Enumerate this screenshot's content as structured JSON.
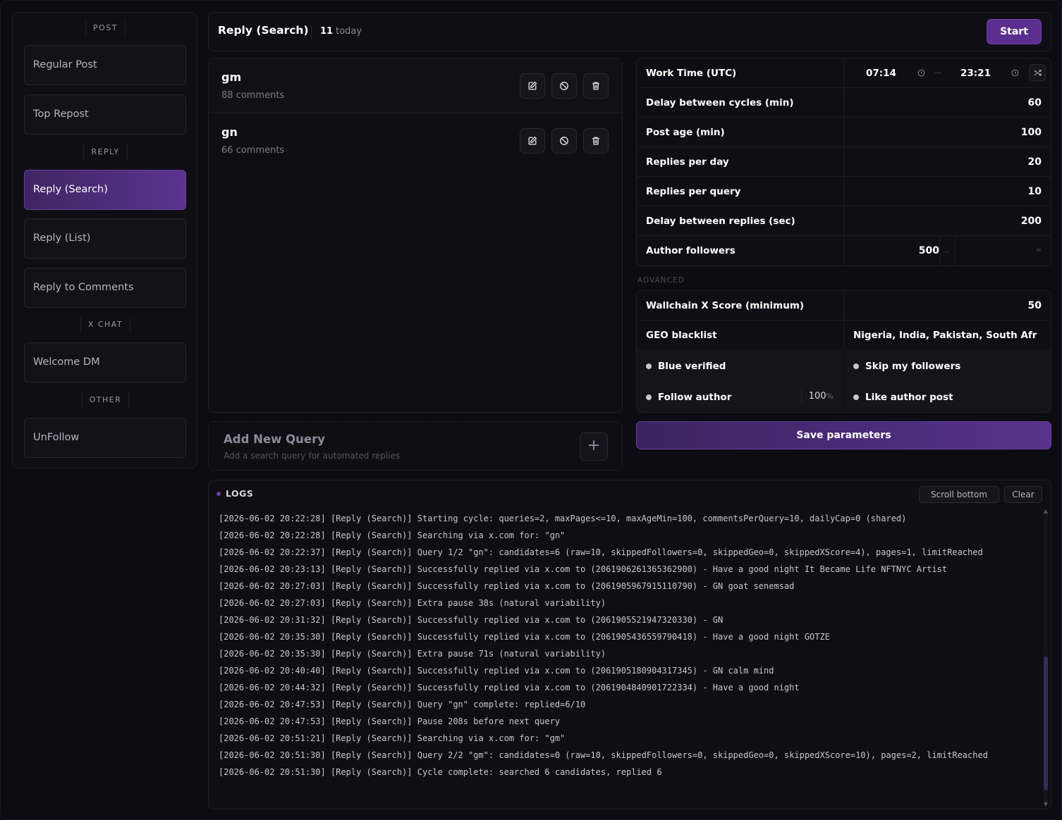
{
  "sidebar": {
    "sections": [
      {
        "label": "POST",
        "items": [
          "Regular Post",
          "Top Repost"
        ]
      },
      {
        "label": "REPLY",
        "items": [
          "Reply (Search)",
          "Reply (List)",
          "Reply to Comments"
        ]
      },
      {
        "label": "X CHAT",
        "items": [
          "Welcome DM"
        ]
      },
      {
        "label": "OTHER",
        "items": [
          "UnFollow"
        ]
      }
    ],
    "active": "Reply (Search)"
  },
  "header": {
    "title": "Reply (Search)",
    "count": "11",
    "count_unit": "today",
    "start_label": "Start"
  },
  "queries": [
    {
      "name": "gm",
      "sub": "88 comments"
    },
    {
      "name": "gn",
      "sub": "66 comments"
    }
  ],
  "add_query": {
    "title": "Add New Query",
    "subtitle": "Add a search query for automated replies",
    "plus": "+"
  },
  "params": {
    "work_time_label": "Work Time (UTC)",
    "work_time_start": "07:14",
    "work_time_end": "23:21",
    "rows": [
      {
        "label": "Delay between cycles (min)",
        "value": "60"
      },
      {
        "label": "Post age (min)",
        "value": "100"
      },
      {
        "label": "Replies per day",
        "value": "20"
      },
      {
        "label": "Replies per query",
        "value": "10"
      },
      {
        "label": "Delay between replies (sec)",
        "value": "200"
      }
    ],
    "author_followers_label": "Author followers",
    "author_followers_min": "500",
    "author_followers_max": "∞"
  },
  "advanced": {
    "label": "ADVANCED",
    "score_label": "Wallchain X Score (minimum)",
    "score_value": "50",
    "geo_label": "GEO blacklist",
    "geo_value": "Nigeria, India, Pakistan, South Afr",
    "toggles": {
      "blue_verified": "Blue verified",
      "skip_followers": "Skip my followers",
      "follow_author": "Follow author",
      "follow_pct": "100",
      "follow_pct_unit": "%",
      "like_post": "Like author post"
    }
  },
  "save_label": "Save parameters",
  "logs": {
    "title": "LOGS",
    "scroll_bottom": "Scroll bottom",
    "clear": "Clear",
    "lines": [
      "[2026-06-02 20:22:28] [Reply (Search)] Starting cycle: queries=2, maxPages<=10, maxAgeMin=100, commentsPerQuery=10, dailyCap=0 (shared)",
      "[2026-06-02 20:22:28] [Reply (Search)] Searching via x.com for: \"gn\"",
      "[2026-06-02 20:22:37] [Reply (Search)] Query 1/2 \"gn\": candidates=6 (raw=10, skippedFollowers=0, skippedGeo=0, skippedXScore=4), pages=1, limitReached",
      "[2026-06-02 20:23:13] [Reply (Search)] Successfully replied via x.com to (2061906261365362900) - Have a good night It Became Life NFTNYC Artist",
      "[2026-06-02 20:27:03] [Reply (Search)] Successfully replied via x.com to (2061905967915110790) - GN goat senemsad",
      "[2026-06-02 20:27:03] [Reply (Search)] Extra pause 38s (natural variability)",
      "[2026-06-02 20:31:32] [Reply (Search)] Successfully replied via x.com to (2061905521947320330) - GN",
      "[2026-06-02 20:35:30] [Reply (Search)] Successfully replied via x.com to (2061905436559790418) - Have a good night GOTZE",
      "[2026-06-02 20:35:30] [Reply (Search)] Extra pause 71s (natural variability)",
      "[2026-06-02 20:40:40] [Reply (Search)] Successfully replied via x.com to (2061905180904317345) - GN calm mind",
      "[2026-06-02 20:44:32] [Reply (Search)] Successfully replied via x.com to (2061904840901722334) - Have a good night",
      "[2026-06-02 20:47:53] [Reply (Search)] Query \"gn\" complete: replied=6/10",
      "[2026-06-02 20:47:53] [Reply (Search)] Pause 208s before next query",
      "[2026-06-02 20:51:21] [Reply (Search)] Searching via x.com for: \"gm\"",
      "[2026-06-02 20:51:30] [Reply (Search)] Query 2/2 \"gm\": candidates=0 (raw=10, skippedFollowers=0, skippedGeo=0, skippedXScore=10), pages=2, limitReached",
      "[2026-06-02 20:51:30] [Reply (Search)] Cycle complete: searched 6 candidates, replied 6"
    ]
  },
  "colors": {
    "accent": "#5a2f8f",
    "background": "#0d0c12",
    "panel": "#0f0e14"
  }
}
